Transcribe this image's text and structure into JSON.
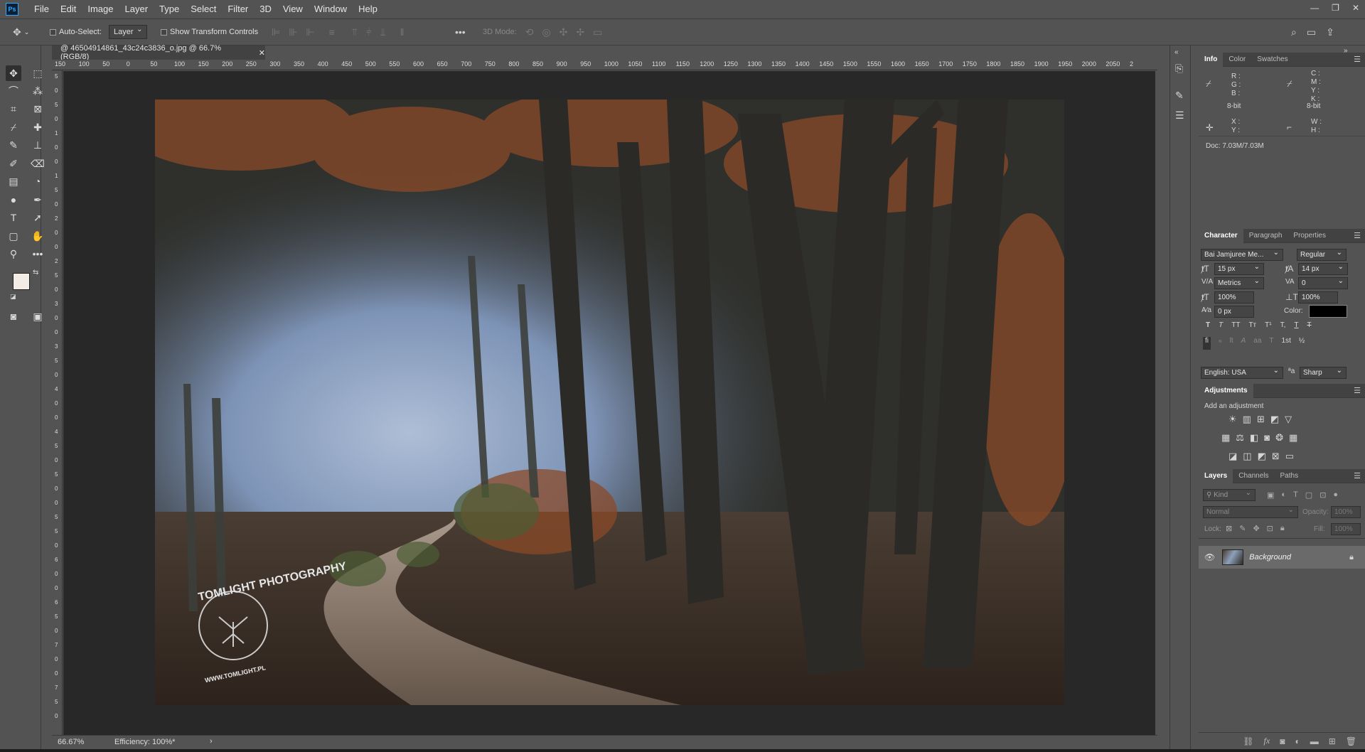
{
  "app": {
    "logo": "Ps"
  },
  "menu": [
    "File",
    "Edit",
    "Image",
    "Layer",
    "Type",
    "Select",
    "Filter",
    "3D",
    "View",
    "Window",
    "Help"
  ],
  "window_controls": {
    "minimize": "—",
    "restore": "❐",
    "close": "✕"
  },
  "options": {
    "auto_select_label": "Auto-Select:",
    "auto_select_value": "Layer",
    "show_transform_label": "Show Transform Controls",
    "more": "•••",
    "mode_3d_label": "3D Mode:"
  },
  "document": {
    "tab_title": "@ 46504914861_43c24c3836_o.jpg @ 66.7% (RGB/8)",
    "close": "✕",
    "ruler_h": [
      "150",
      "100",
      "50",
      "0",
      "50",
      "100",
      "150",
      "200",
      "250",
      "300",
      "350",
      "400",
      "450",
      "500",
      "550",
      "600",
      "650",
      "700",
      "750",
      "800",
      "850",
      "900",
      "950",
      "1000",
      "1050",
      "1100",
      "1150",
      "1200",
      "1250",
      "1300",
      "1350",
      "1400",
      "1450",
      "1500",
      "1550",
      "1600",
      "1650",
      "1700",
      "1750",
      "1800",
      "1850",
      "1900",
      "1950",
      "2000",
      "2050",
      "2"
    ],
    "ruler_v": [
      "5",
      "0",
      "5",
      "0",
      "1",
      "0",
      "0",
      "1",
      "5",
      "0",
      "2",
      "0",
      "0",
      "2",
      "5",
      "0",
      "3",
      "0",
      "0",
      "3",
      "5",
      "0",
      "4",
      "0",
      "0",
      "4",
      "5",
      "0",
      "5",
      "0",
      "0",
      "5",
      "5",
      "0",
      "6",
      "0",
      "0",
      "6",
      "5",
      "0",
      "7",
      "0",
      "0",
      "7",
      "5",
      "0"
    ],
    "watermark_title": "TOMLIGHT PHOTOGRAPHY",
    "watermark_url": "WWW.TOMLIGHT.PL"
  },
  "status": {
    "zoom": "66.67%",
    "efficiency": "Efficiency: 100%*",
    "arrow": "›"
  },
  "info_panel": {
    "tabs": [
      "Info",
      "Color",
      "Swatches"
    ],
    "rgb": [
      "R :",
      "G :",
      "B :"
    ],
    "cmyk": [
      "C :",
      "M :",
      "Y :",
      "K :"
    ],
    "bit_left": "8-bit",
    "bit_right": "8-bit",
    "xy": [
      "X :",
      "Y :"
    ],
    "wh": [
      "W :",
      "H :"
    ],
    "doc": "Doc: 7.03M/7.03M"
  },
  "character_panel": {
    "tabs": [
      "Character",
      "Paragraph",
      "Properties"
    ],
    "font": "Bai Jamjuree Me...",
    "style": "Regular",
    "size": "15 px",
    "leading": "14 px",
    "kerning": "Metrics",
    "tracking": "0",
    "vscale": "100%",
    "hscale": "100%",
    "baseline": "0 px",
    "color_label": "Color:",
    "color": "#000000",
    "styles1": [
      "T",
      "T",
      "TT",
      "Tт",
      "T¹",
      "T,",
      "T",
      "T"
    ],
    "styles2": [
      "fi",
      "ℴ",
      "ſt",
      "A",
      "aa",
      "T",
      "1st",
      "½"
    ],
    "language": "English: USA",
    "aa_label": "a",
    "antialias": "Sharp"
  },
  "adjustments": {
    "title": "Adjustments",
    "subtitle": "Add an adjustment"
  },
  "layers_panel": {
    "tabs": [
      "Layers",
      "Channels",
      "Paths"
    ],
    "kind": "Kind",
    "blend": "Normal",
    "opacity_label": "Opacity:",
    "opacity": "100%",
    "lock_label": "Lock:",
    "fill_label": "Fill:",
    "fill": "100%",
    "layer_name": "Background",
    "footer_icons": [
      "link-icon",
      "fx-icon",
      "mask-icon",
      "adjustment-icon",
      "folder-icon",
      "new-layer-icon",
      "trash-icon"
    ]
  },
  "colors": {
    "foreground": "#f3ece4",
    "background": "#e0b394",
    "accent": "#31a8ff"
  }
}
